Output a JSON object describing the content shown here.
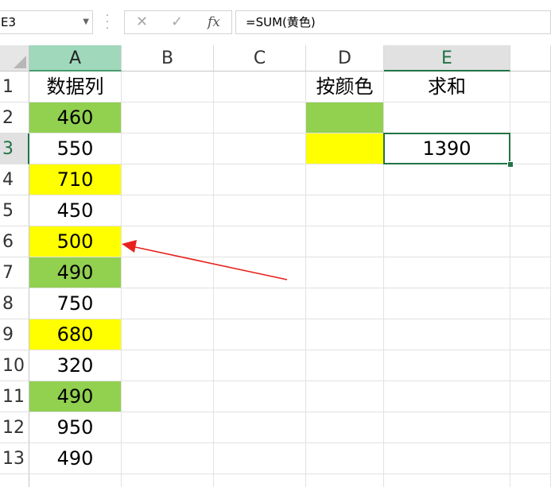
{
  "name_box": "E3",
  "formula_bar": {
    "cancel_icon": "✕",
    "enter_icon": "✓",
    "fx_label": "fx",
    "formula": "=SUM(黄色)"
  },
  "columns": [
    "A",
    "B",
    "C",
    "D",
    "E"
  ],
  "rows": [
    "1",
    "2",
    "3",
    "4",
    "5",
    "6",
    "7",
    "8",
    "9",
    "10",
    "11",
    "12",
    "13"
  ],
  "colors": {
    "green": "#92d050",
    "yellow": "#ffff00",
    "selection": "#217346",
    "arrow": "#e8211c"
  },
  "cells": {
    "A1": "数据列",
    "A2": "460",
    "A3": "550",
    "A4": "710",
    "A5": "450",
    "A6": "500",
    "A7": "490",
    "A8": "750",
    "A9": "680",
    "A10": "320",
    "A11": "490",
    "A12": "950",
    "A13": "490",
    "D1": "按颜色",
    "E1": "求和",
    "E3": "1390"
  },
  "fills": {
    "A2": "green",
    "A4": "yellow",
    "A6": "yellow",
    "A7": "green",
    "A9": "yellow",
    "A11": "green",
    "D2": "green",
    "D3": "yellow"
  },
  "selected_cell": "E3",
  "annotation": {
    "type": "arrow",
    "color": "red",
    "points_to": "A6"
  }
}
